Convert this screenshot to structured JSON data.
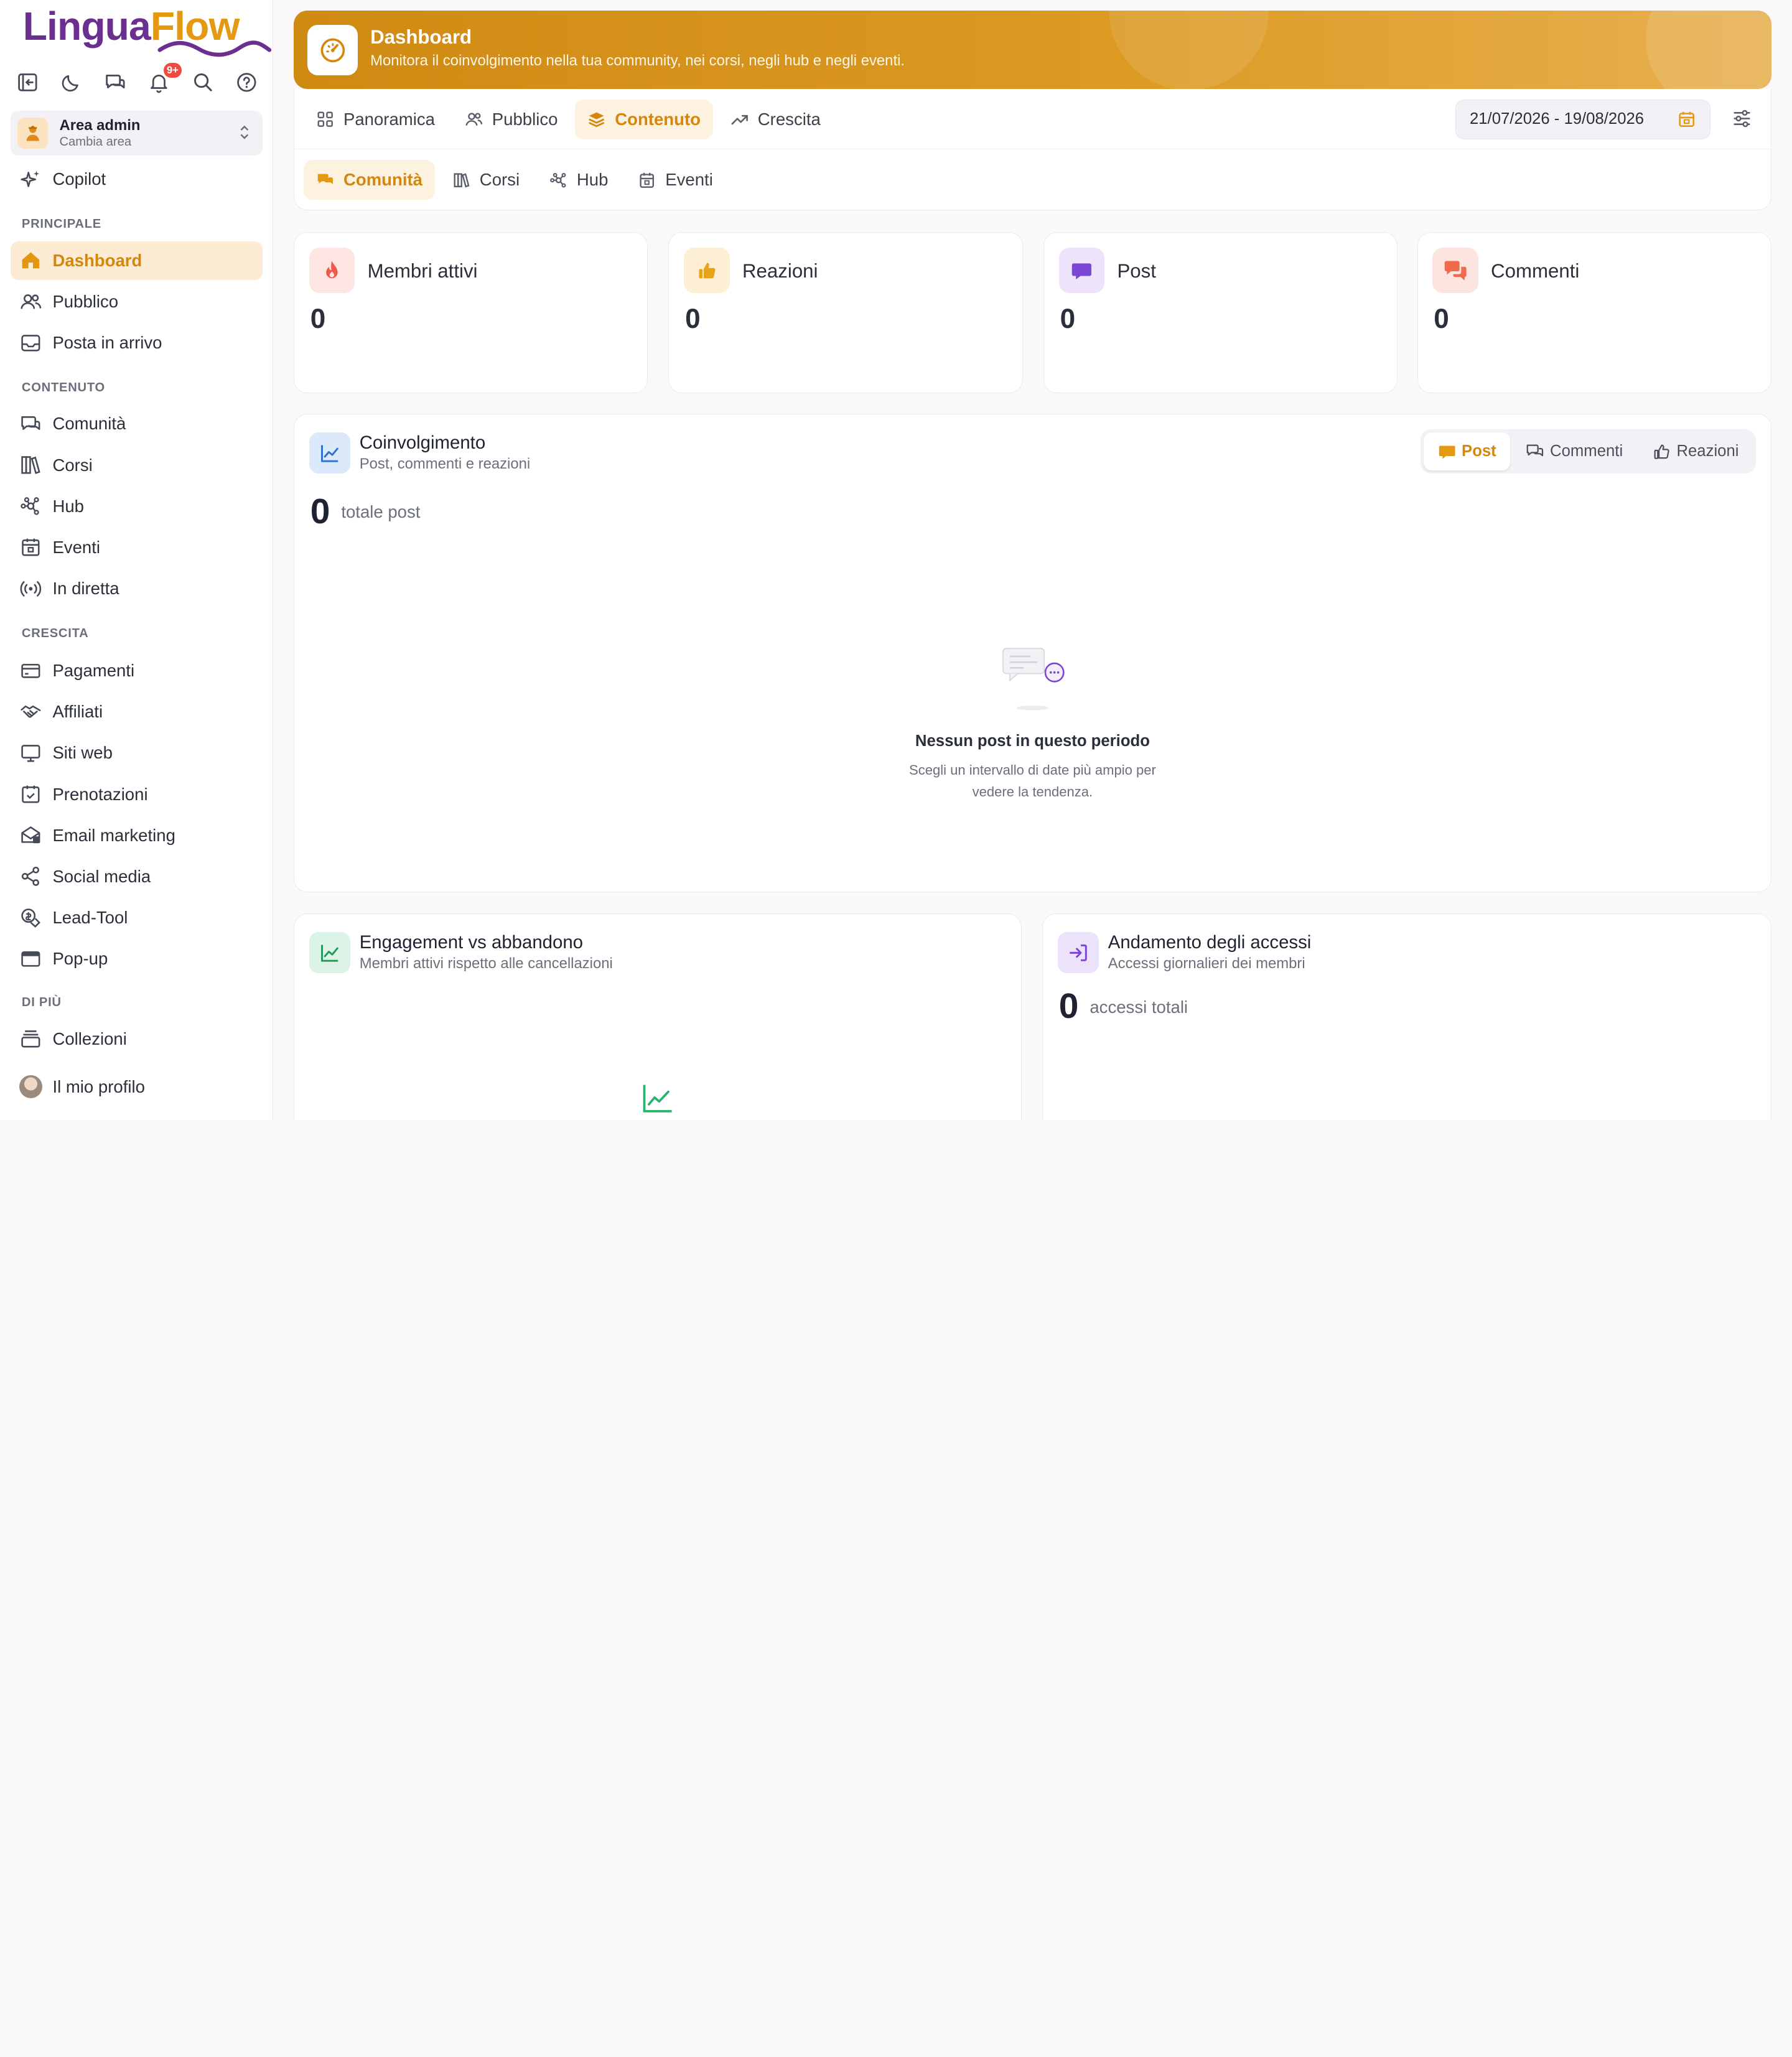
{
  "app": {
    "logo_part1": "Lingua",
    "logo_part2": "Flow",
    "notifications_badge": "9+"
  },
  "area": {
    "title": "Area admin",
    "subtitle": "Cambia area"
  },
  "sidebar": {
    "copilot": "Copilot",
    "sections": {
      "principale": "PRINCIPALE",
      "contenuto": "CONTENUTO",
      "crescita": "CRESCITA",
      "di_piu": "DI PIÙ"
    },
    "principale": [
      "Dashboard",
      "Pubblico",
      "Posta in arrivo"
    ],
    "contenuto": [
      "Comunità",
      "Corsi",
      "Hub",
      "Eventi",
      "In diretta"
    ],
    "crescita": [
      "Pagamenti",
      "Affiliati",
      "Siti web",
      "Prenotazioni",
      "Email marketing",
      "Social media",
      "Lead-Tool",
      "Pop-up"
    ],
    "di_piu": [
      "Collezioni"
    ],
    "profile": "Il mio profilo"
  },
  "header": {
    "title": "Dashboard",
    "subtitle": "Monitora il coinvolgimento nella tua community, nei corsi, negli hub e negli eventi."
  },
  "tabs": [
    "Panoramica",
    "Pubblico",
    "Contenuto",
    "Crescita"
  ],
  "active_tab": "Contenuto",
  "subtabs": [
    "Comunità",
    "Corsi",
    "Hub",
    "Eventi"
  ],
  "active_subtab": "Comunità",
  "date_range": "21/07/2026 - 19/08/2026",
  "stats": [
    {
      "label": "Membri attivi",
      "value": "0",
      "color": "#f0584a"
    },
    {
      "label": "Reazioni",
      "value": "0",
      "color": "#e8a317"
    },
    {
      "label": "Post",
      "value": "0",
      "color": "#7b45d6"
    },
    {
      "label": "Commenti",
      "value": "0",
      "color": "#f06a4e"
    }
  ],
  "engagement": {
    "title": "Coinvolgimento",
    "subtitle": "Post, commenti e reazioni",
    "segments": [
      "Post",
      "Commenti",
      "Reazioni"
    ],
    "active_segment": "Post",
    "count": "0",
    "count_label": "totale post",
    "empty_title": "Nessun post in questo periodo",
    "empty_sub": "Scegli un intervallo di date più ampio per vedere la tendenza."
  },
  "churn": {
    "title": "Engagement vs abbandono",
    "subtitle": "Membri attivi rispetto alle cancellazioni"
  },
  "logins": {
    "title": "Andamento degli accessi",
    "subtitle": "Accessi giornalieri dei membri",
    "count": "0",
    "count_label": "accessi totali"
  },
  "colors": {
    "accent": "#d5870c",
    "brand_purple": "#6b2f8f",
    "active_bg": "#fdebd3"
  }
}
